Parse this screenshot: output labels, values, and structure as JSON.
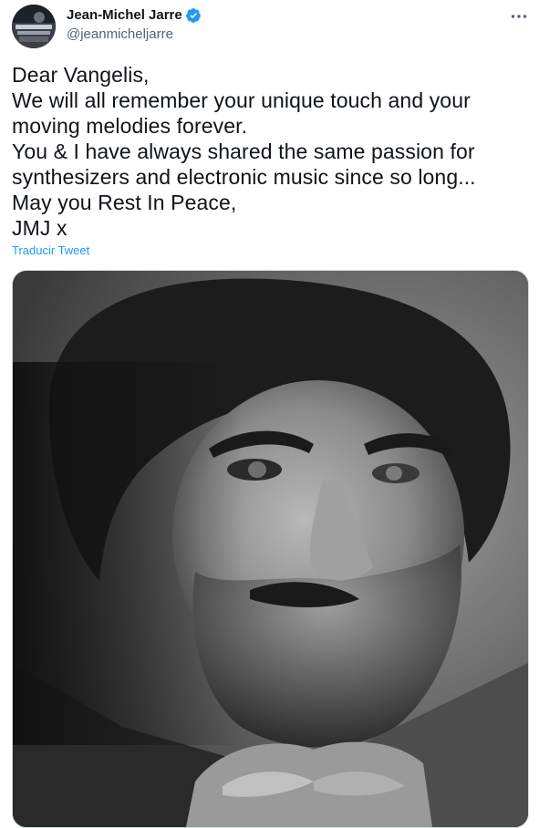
{
  "author": {
    "display_name": "Jean-Michel Jarre",
    "handle": "@jeanmicheljarre",
    "verified": true,
    "avatar_icon": "avatar-photo"
  },
  "tweet": {
    "lines": [
      "Dear Vangelis,",
      "We will all remember your unique touch and your",
      "moving melodies forever.",
      "You & I have always shared  the same passion for",
      "synthesizers and electronic music since so long...",
      "May you Rest In Peace,",
      "JMJ x"
    ],
    "translate_label": "Traducir Tweet"
  },
  "media": {
    "kind": "black-and-white portrait photo"
  },
  "colors": {
    "link": "#1d9bf0",
    "verified_badge": "#1d9bf0",
    "secondary_text": "#536471"
  },
  "icons": {
    "more": "more-horizontal-icon",
    "verified": "verified-badge-icon"
  }
}
